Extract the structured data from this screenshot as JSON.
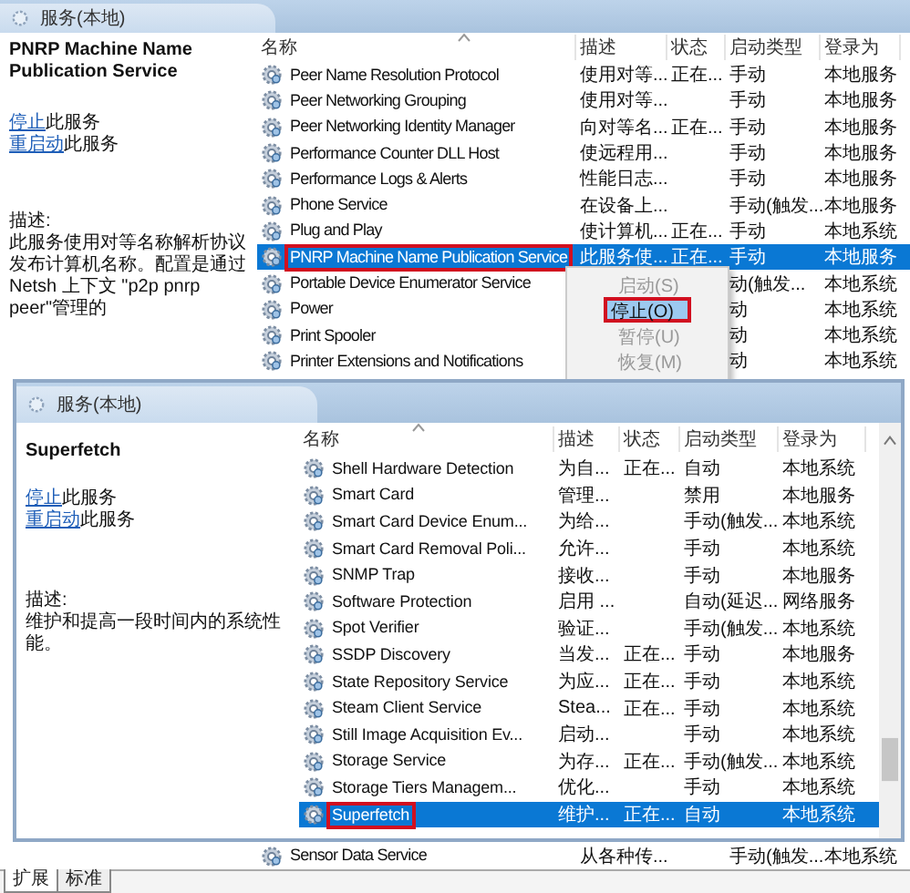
{
  "back_window": {
    "title": "服务(本地)",
    "service_name": "PNRP Machine Name Publication Service",
    "actions": [
      {
        "link": "停止",
        "text": "此服务"
      },
      {
        "link": "重启动",
        "text": "此服务"
      }
    ],
    "description_label": "描述:",
    "description": "此服务使用对等名称解析协议发布计算机名称。配置是通过 Netsh 上下文 \"p2p pnrp peer\"管理的",
    "columns": [
      "名称",
      "描述",
      "状态",
      "启动类型",
      "登录为"
    ],
    "rows": [
      {
        "name": "Peer Name Resolution Protocol",
        "description": "使用对等...",
        "status": "正在...",
        "startup": "手动",
        "logon": "本地服务",
        "selected": false,
        "highlighted": false
      },
      {
        "name": "Peer Networking Grouping",
        "description": "使用对等...",
        "startup": "手动",
        "logon": "本地服务",
        "selected": false,
        "highlighted": false
      },
      {
        "name": "Peer Networking Identity Manager",
        "description": "向对等名...",
        "status": "正在...",
        "startup": "手动",
        "logon": "本地服务",
        "selected": false,
        "highlighted": false
      },
      {
        "name": "Performance Counter DLL Host",
        "description": "使远程用...",
        "startup": "手动",
        "logon": "本地服务",
        "selected": false,
        "highlighted": false
      },
      {
        "name": "Performance Logs & Alerts",
        "description": "性能日志...",
        "startup": "手动",
        "logon": "本地服务",
        "selected": false,
        "highlighted": false
      },
      {
        "name": "Phone Service",
        "description": "在设备上...",
        "startup": "手动(触发...",
        "logon": "本地服务",
        "selected": false,
        "highlighted": false
      },
      {
        "name": "Plug and Play",
        "description": "使计算机...",
        "status": "正在...",
        "startup": "手动",
        "logon": "本地系统",
        "selected": false,
        "highlighted": false
      },
      {
        "name": "PNRP Machine Name Publication Service",
        "description": "此服务使...",
        "status": "正在...",
        "startup": "手动",
        "logon": "本地服务",
        "selected": true,
        "highlighted": true
      },
      {
        "name": "Portable Device Enumerator Service",
        "startup": "动(触发...",
        "logon": "本地系统",
        "selected": false,
        "highlighted": false
      },
      {
        "name": "Power",
        "startup": "动",
        "logon": "本地系统",
        "selected": false,
        "highlighted": false
      },
      {
        "name": "Print Spooler",
        "startup": "动",
        "logon": "本地系统",
        "selected": false,
        "highlighted": false
      },
      {
        "name": "Printer Extensions and Notifications",
        "startup": "动",
        "logon": "本地系统",
        "selected": false,
        "highlighted": false
      }
    ],
    "bottom_rows": [
      {
        "name": "Sensor Data Service",
        "description": "从各种传...",
        "startup": "手动(触发...",
        "logon": "本地系统",
        "selected": false,
        "highlighted": false
      }
    ],
    "context_menu": {
      "items": [
        {
          "label": "启动(S)",
          "disabled": true,
          "selected": false,
          "highlighted": false
        },
        {
          "label": "停止(O)",
          "disabled": false,
          "selected": true,
          "highlighted": true
        },
        {
          "label": "暂停(U)",
          "disabled": true,
          "selected": false,
          "highlighted": false
        },
        {
          "label": "恢复(M)",
          "disabled": true,
          "selected": false,
          "highlighted": false
        }
      ]
    },
    "tabs": [
      {
        "label": "扩展",
        "selected": true
      },
      {
        "label": "标准",
        "selected": false
      }
    ]
  },
  "front_window": {
    "title": "服务(本地)",
    "service_name": "Superfetch",
    "actions": [
      {
        "link": "停止",
        "text": "此服务"
      },
      {
        "link": "重启动",
        "text": "此服务"
      }
    ],
    "description_label": "描述:",
    "description": "维护和提高一段时间内的系统性能。",
    "columns": [
      "名称",
      "描述",
      "状态",
      "启动类型",
      "登录为"
    ],
    "rows": [
      {
        "name": "Shell Hardware Detection",
        "description": "为自...",
        "status": "正在...",
        "startup": "自动",
        "logon": "本地系统",
        "selected": false,
        "highlighted": false
      },
      {
        "name": "Smart Card",
        "description": "管理...",
        "startup": "禁用",
        "logon": "本地服务",
        "selected": false,
        "highlighted": false
      },
      {
        "name": "Smart Card Device Enum...",
        "description": "为给...",
        "startup": "手动(触发...",
        "logon": "本地系统",
        "selected": false,
        "highlighted": false
      },
      {
        "name": "Smart Card Removal Poli...",
        "description": "允许...",
        "startup": "手动",
        "logon": "本地系统",
        "selected": false,
        "highlighted": false
      },
      {
        "name": "SNMP Trap",
        "description": "接收...",
        "startup": "手动",
        "logon": "本地服务",
        "selected": false,
        "highlighted": false
      },
      {
        "name": "Software Protection",
        "description": "启用 ...",
        "startup": "自动(延迟...",
        "logon": "网络服务",
        "selected": false,
        "highlighted": false
      },
      {
        "name": "Spot Verifier",
        "description": "验证...",
        "startup": "手动(触发...",
        "logon": "本地系统",
        "selected": false,
        "highlighted": false
      },
      {
        "name": "SSDP Discovery",
        "description": "当发...",
        "status": "正在...",
        "startup": "手动",
        "logon": "本地服务",
        "selected": false,
        "highlighted": false
      },
      {
        "name": "State Repository Service",
        "description": "为应...",
        "status": "正在...",
        "startup": "手动",
        "logon": "本地系统",
        "selected": false,
        "highlighted": false
      },
      {
        "name": "Steam Client Service",
        "description": "Stea...",
        "status": "正在...",
        "startup": "手动",
        "logon": "本地系统",
        "selected": false,
        "highlighted": false
      },
      {
        "name": "Still Image Acquisition Ev...",
        "description": "启动...",
        "startup": "手动",
        "logon": "本地系统",
        "selected": false,
        "highlighted": false
      },
      {
        "name": "Storage Service",
        "description": "为存...",
        "status": "正在...",
        "startup": "手动(触发...",
        "logon": "本地系统",
        "selected": false,
        "highlighted": false
      },
      {
        "name": "Storage Tiers Managem...",
        "description": "优化...",
        "startup": "手动",
        "logon": "本地系统",
        "selected": false,
        "highlighted": false
      },
      {
        "name": "Superfetch",
        "description": "维护...",
        "status": "正在...",
        "startup": "自动",
        "logon": "本地系统",
        "selected": true,
        "highlighted": true
      }
    ]
  }
}
